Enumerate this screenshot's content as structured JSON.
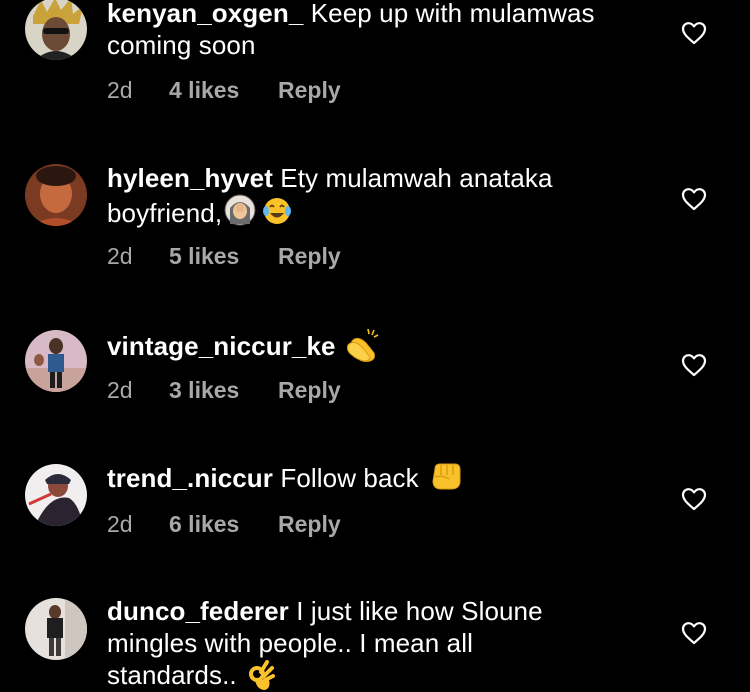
{
  "comments": [
    {
      "username": "kenyan_oxgen_",
      "text": "Keep up with mulamwas coming soon",
      "time": "2d",
      "likes": "4 likes",
      "reply": "Reply"
    },
    {
      "username": "hyleen_hyvet",
      "text": "Ety mulamwah anataka boyfriend,",
      "emojis": [
        "woman-facepalming-icon",
        "tears-of-joy-icon"
      ],
      "time": "2d",
      "likes": "5 likes",
      "reply": "Reply"
    },
    {
      "username": "vintage_niccur_ke",
      "text": "",
      "emojis": [
        "clapping-hands-icon"
      ],
      "time": "2d",
      "likes": "3 likes",
      "reply": "Reply"
    },
    {
      "username": "trend_.niccur",
      "text": "Follow back",
      "emojis": [
        "fist-bump-icon"
      ],
      "time": "2d",
      "likes": "6 likes",
      "reply": "Reply"
    },
    {
      "username": "dunco_federer",
      "text": "I just like how Sloune mingles with people.. I mean all standards..",
      "emojis": [
        "ok-hand-icon"
      ]
    }
  ],
  "colors": {
    "background": "#000000",
    "text": "#ffffff",
    "meta": "#a8a8a8",
    "emoji": "#f9c22b"
  }
}
